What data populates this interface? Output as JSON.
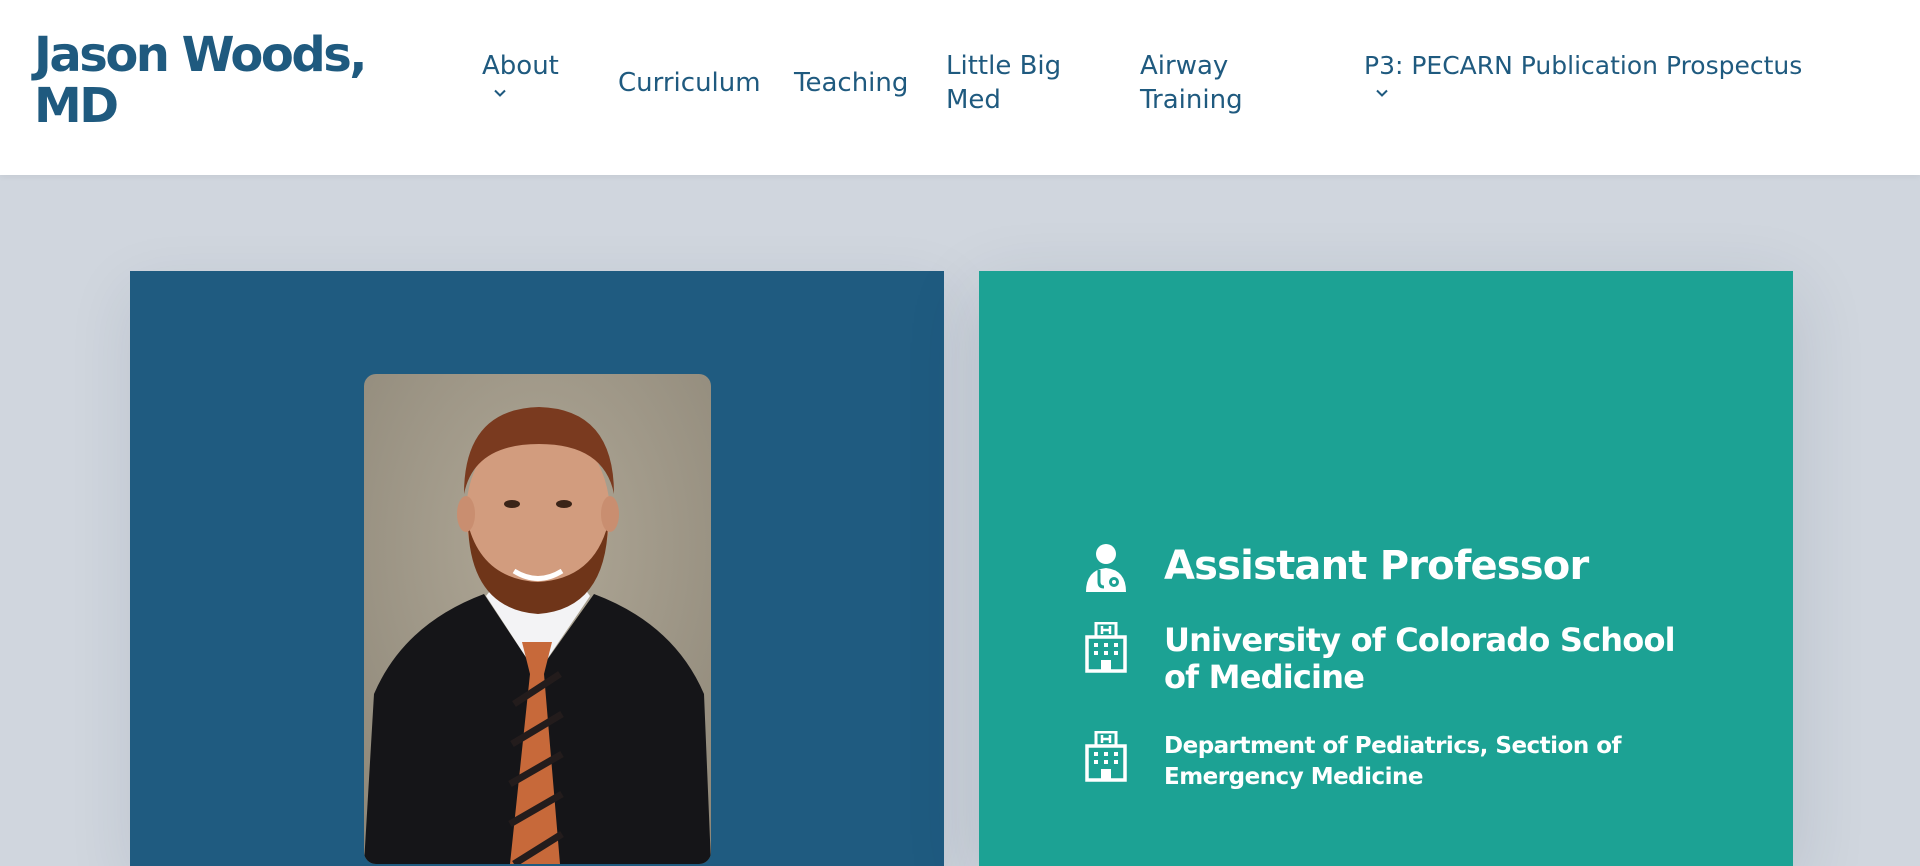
{
  "site": {
    "title": "Jason Woods, MD"
  },
  "nav": {
    "items": [
      {
        "label": "About",
        "has_dropdown": true
      },
      {
        "label": "Curriculum",
        "has_dropdown": false
      },
      {
        "label": "Teaching",
        "has_dropdown": false
      },
      {
        "label": "Little Big Med",
        "has_dropdown": false
      },
      {
        "label": "Airway Training",
        "has_dropdown": false
      },
      {
        "label": "P3: PECARN Publication Prospectus",
        "has_dropdown": true
      }
    ]
  },
  "profile": {
    "photo_icon": "portrait-photo",
    "items": [
      {
        "icon": "doctor-icon",
        "text": "Assistant Professor"
      },
      {
        "icon": "hospital-icon",
        "text": "University of Colorado School of Medicine"
      },
      {
        "icon": "hospital-icon",
        "text": "Department of Pediatrics, Section of Emergency Medicine"
      }
    ]
  },
  "colors": {
    "brand": "#1f5a7f",
    "left_panel": "#1f5b80",
    "right_panel": "#1ca294",
    "page_background": "#d0d6de",
    "header_background": "#ffffff"
  }
}
